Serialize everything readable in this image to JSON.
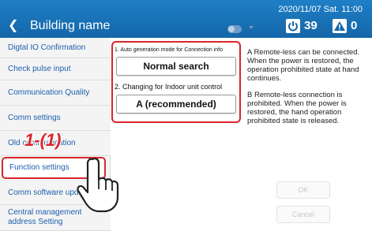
{
  "header": {
    "back_icon": "chevron-left-icon",
    "back_glyph": "❮",
    "building_name": "Building name",
    "datetime": "2020/11/07 Sat. 11:00",
    "power_count": "39",
    "warning_count": "0",
    "toggle_icon": "toggle-switch-icon",
    "power_icon": "power-icon",
    "warning_icon": "warning-triangle-icon"
  },
  "sidebar": {
    "items": [
      {
        "label": "Digtal IO Confirmation"
      },
      {
        "label": "Check pulse input"
      },
      {
        "label": "Communication Quality"
      },
      {
        "label": "Comm settings"
      },
      {
        "label": "Old communication"
      },
      {
        "label": "Function settings"
      },
      {
        "label": "Comm software update"
      },
      {
        "label": "Central management address Setting"
      }
    ]
  },
  "main": {
    "section1_label": "1. Auto generation mode for Connection info",
    "section1_value": "Normal search",
    "section2_label": "2. Changing for Indoor unit control",
    "section2_value": "A (recommended)",
    "info_a": "A  Remote-less can be connected. When the power is restored, the operation prohibited state at hand continues.",
    "info_b": "B  Remote-less connection is prohibited. When the power is restored, the hand operation prohibited state is released.",
    "ok_label": "OK",
    "cancel_label": "Cancel"
  },
  "annotation": {
    "step_label": "1-(1)",
    "pointer_icon": "pointing-hand-icon"
  },
  "colors": {
    "header_blue": "#1a73bb",
    "highlight_red": "#d9262c",
    "sidebar_text": "#1b5fae",
    "disabled_text": "#c7c7c7"
  }
}
